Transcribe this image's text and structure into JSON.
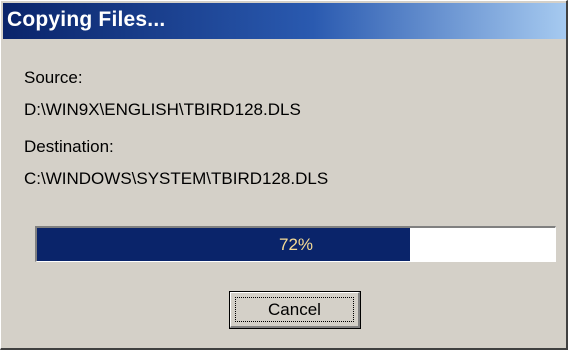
{
  "window": {
    "title": "Copying Files..."
  },
  "source": {
    "label": "Source:",
    "path": "D:\\WIN9X\\ENGLISH\\TBIRD128.DLS"
  },
  "destination": {
    "label": "Destination:",
    "path": "C:\\WINDOWS\\SYSTEM\\TBIRD128.DLS"
  },
  "progress": {
    "percent": 72,
    "text": "72%"
  },
  "buttons": {
    "cancel_label": "Cancel"
  },
  "colors": {
    "titlebar_start": "#0a246a",
    "progress_fill": "#0a246a",
    "dialog_face": "#d4d0c8"
  }
}
